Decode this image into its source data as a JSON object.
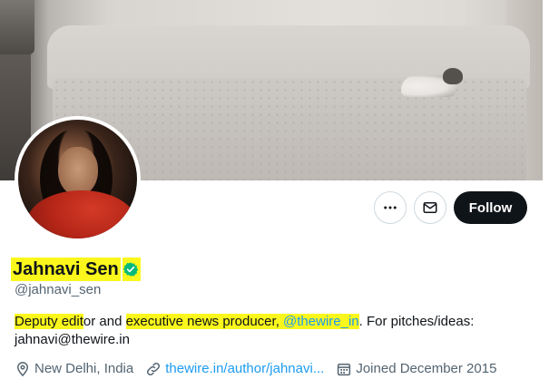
{
  "profile": {
    "display_name": "Jahnavi Sen",
    "handle": "@jahnavi_sen",
    "verified": true,
    "bio": {
      "part1_hl": "Deputy edit",
      "part2": "or and ",
      "part3_hl": "executive news producer, ",
      "mention": "@thewire_in",
      "part4": ". For pitches/ideas:",
      "line2": "jahnavi@thewire.in"
    },
    "location": "New Delhi, India",
    "website": "thewire.in/author/jahnavi...",
    "joined": "Joined December 2015"
  },
  "actions": {
    "more_label": "More",
    "message_label": "Message",
    "follow_label": "Follow"
  },
  "colors": {
    "highlight": "#fbf71c",
    "link": "#1d9bf0",
    "verified_badge": "#00ba7c",
    "follow_button": "#0f1419"
  },
  "icons": {
    "more": "ellipsis-icon",
    "message": "envelope-icon",
    "verified": "verified-badge-icon",
    "location": "map-pin-icon",
    "link": "link-icon",
    "calendar": "calendar-icon"
  }
}
